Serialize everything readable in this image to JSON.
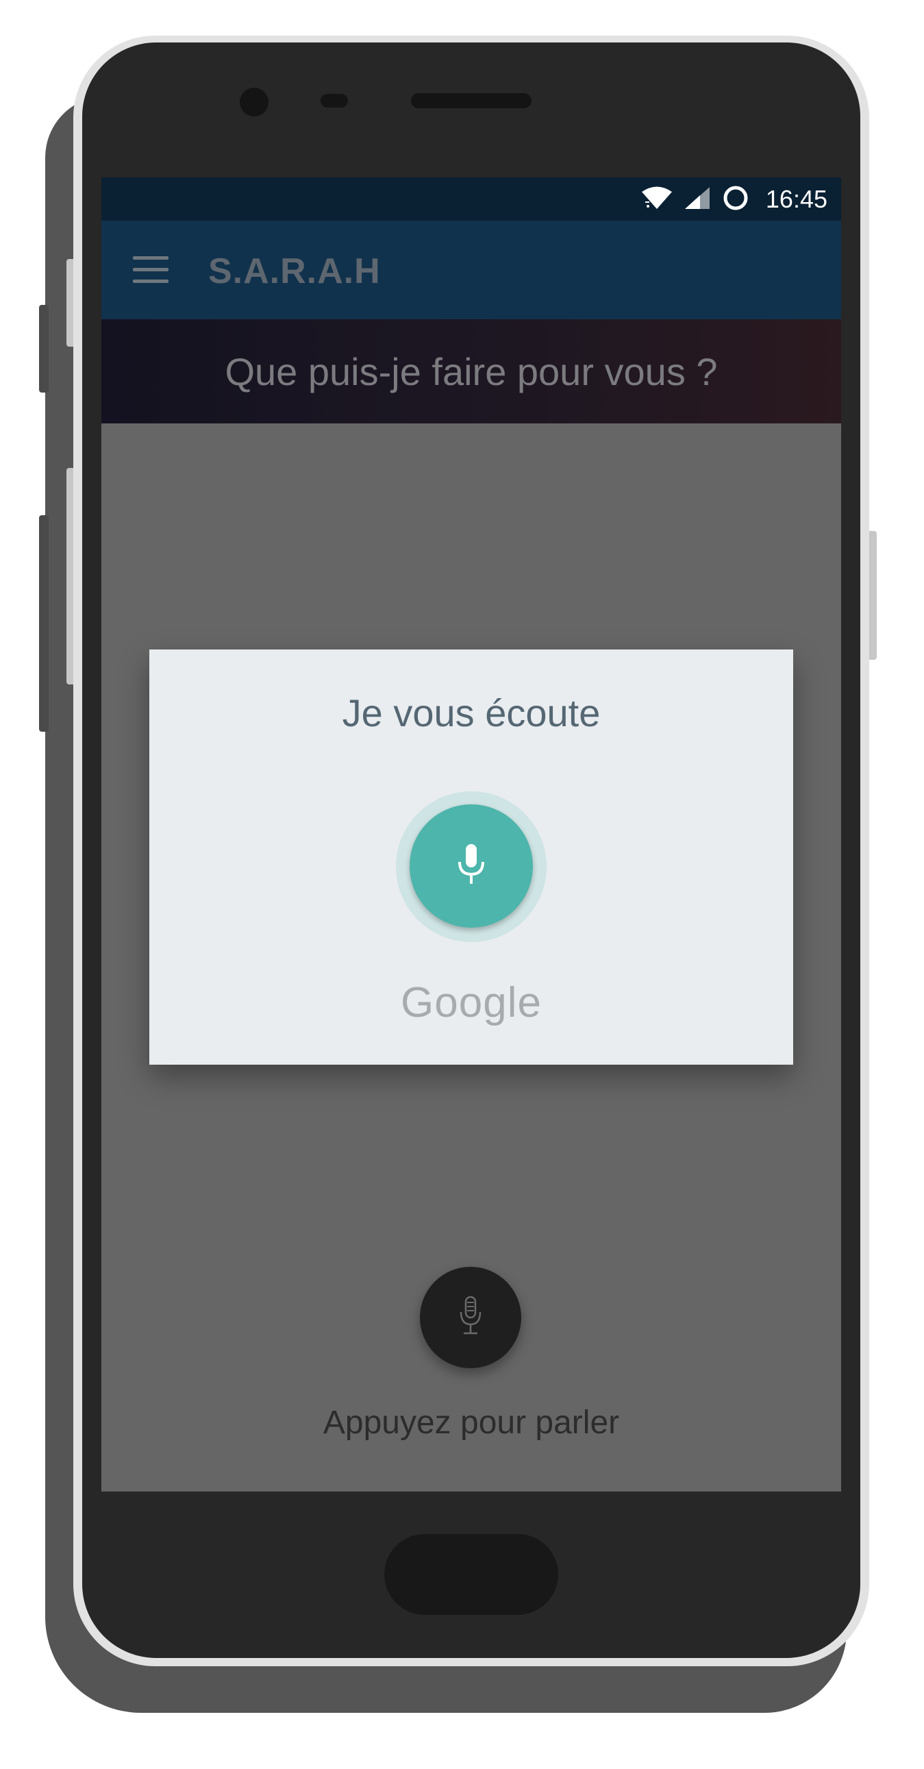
{
  "status_bar": {
    "time": "16:45",
    "icons": [
      "wifi-icon",
      "signal-icon",
      "sync-circle-icon"
    ]
  },
  "toolbar": {
    "menu_icon": "hamburger-menu-icon",
    "title": "S.A.R.A.H"
  },
  "prompt": {
    "text": "Que puis-je faire pour vous ?"
  },
  "voice_dialog": {
    "title": "Je vous écoute",
    "mic_icon": "microphone-icon",
    "brand": "Google",
    "accent_color": "#4db5ab"
  },
  "talk_button": {
    "icon": "microphone-icon",
    "label": "Appuyez pour parler"
  },
  "colors": {
    "status_bar": "#0a2033",
    "toolbar": "#11324c",
    "screen_dim": "#666666"
  }
}
